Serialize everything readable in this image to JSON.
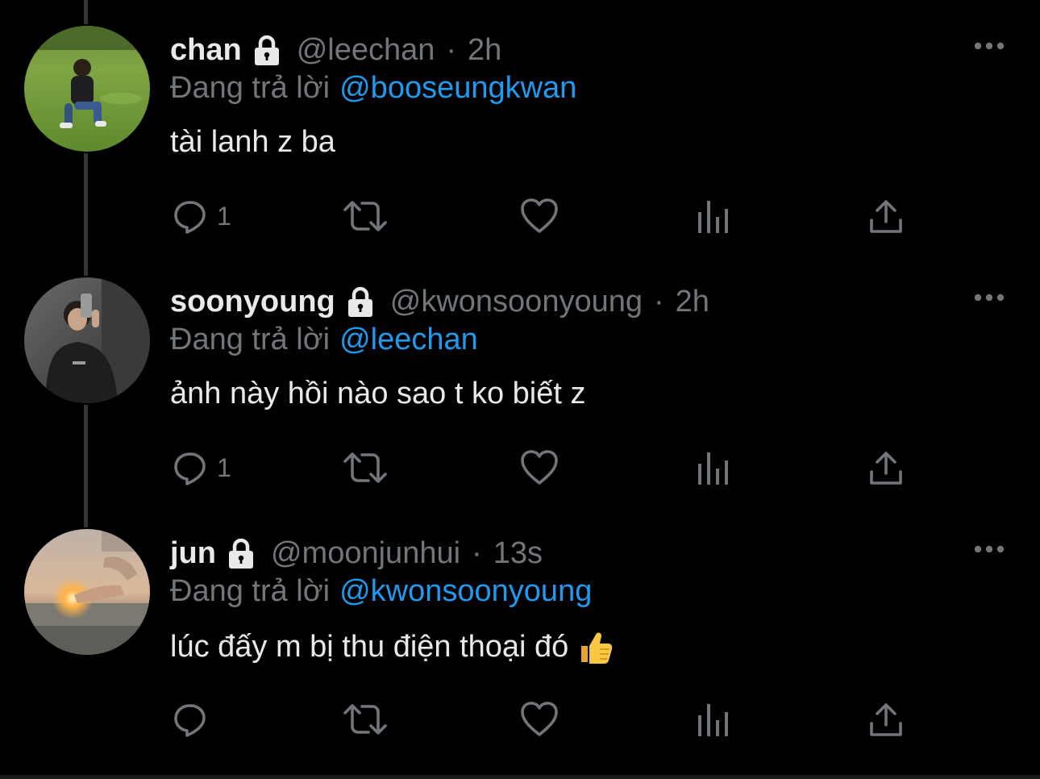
{
  "colors": {
    "background": "#000000",
    "text_primary": "#e7e9ea",
    "text_secondary": "#71767b",
    "accent": "#1d9bf0",
    "thread_line": "#333639"
  },
  "icons": {
    "lock": "lock-icon",
    "more": "more-horizontal-icon",
    "reply": "reply-icon",
    "retweet": "retweet-icon",
    "like": "heart-icon",
    "analytics": "analytics-icon",
    "share": "share-icon",
    "thumbs_up": "thumbs-up-emoji"
  },
  "tweets": [
    {
      "name": "chan",
      "handle": "@leechan",
      "separator": "·",
      "time": "2h",
      "replying_prefix": "Đang trả lời",
      "replying_to": "@booseungkwan",
      "text": "tài lanh z ba",
      "reply_count": "1",
      "avatar_scene": "person-on-grass"
    },
    {
      "name": "soonyoung",
      "handle": "@kwonsoonyoung",
      "separator": "·",
      "time": "2h",
      "replying_prefix": "Đang trả lời",
      "replying_to": "@leechan",
      "text": "ảnh này hồi nào sao t ko biết z",
      "reply_count": "1",
      "avatar_scene": "mirror-selfie"
    },
    {
      "name": "jun",
      "handle": "@moonjunhui",
      "separator": "·",
      "time": "13s",
      "replying_prefix": "Đang trả lời",
      "replying_to": "@kwonsoonyoung",
      "text": "lúc đấy m bị thu điện thoại đó",
      "reply_count": "",
      "avatar_scene": "sunset-sea-hand"
    }
  ]
}
